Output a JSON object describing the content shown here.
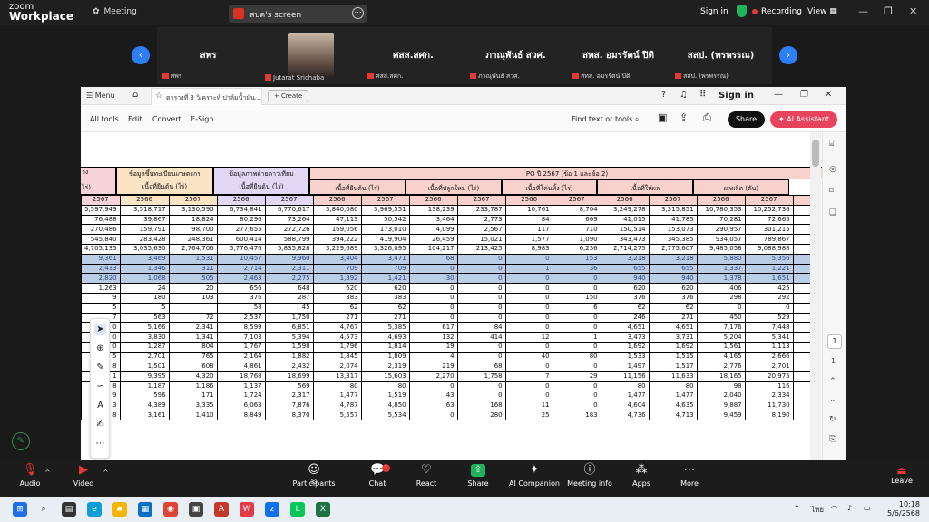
{
  "zoom": {
    "logo_line1": "zoom",
    "logo_line2": "Workplace",
    "meeting_label": "Meeting",
    "share_pill": "สปค's screen",
    "sign_in": "Sign in",
    "recording": "Recording",
    "view": "View"
  },
  "participants": [
    {
      "big": "สพร",
      "small": "สพร"
    },
    {
      "big": "",
      "small": "Jutarat Srichaba"
    },
    {
      "big": "ศสส.สศก.",
      "small": "ศสส.สศก."
    },
    {
      "big": "ภาณุพันธ์ สวศ.",
      "small": "ภาณุพันธ์ สวศ."
    },
    {
      "big": "สทส. อมรรัตน์  ปิติ",
      "small": "สทส. อมรรัตน์  ปิติ"
    },
    {
      "big": "สสป. (พรพรรณ)",
      "small": "สสป. (พรพรรณ)"
    }
  ],
  "pdf": {
    "menu": "Menu",
    "tab_title": "ตารางที่ 3 วิเคราะห์ ปาล์มน้ำมัน...",
    "create": "Create",
    "sign_in": "Sign in",
    "toolbar": [
      "All tools",
      "Edit",
      "Convert",
      "E-Sign"
    ],
    "find": "Find text or tools",
    "share": "Share",
    "ai": "AI Assistant",
    "page_current": "1",
    "page_total": "1"
  },
  "table": {
    "group_left": "าง",
    "group1_title": "ข้อมูลขึ้นทะเบียนเกษตรกร",
    "group1_sub": "เนื้อที่ยืนต้น (ไร่)",
    "group2_title": "ข้อมูลภาพถ่ายดาวเทียม",
    "group2_sub": "เนื้อที่ยืนต้น (ไร่)",
    "po_title": "PO ปี 2567 (ข้อ 1 และข้อ 2)",
    "po_subs": [
      "เนื้อที่ยืนต้น (ไร่)",
      "เนื้อที่ปลูกใหม่ (ไร่)",
      "เนื้อที่โค่นทิ้ง (ไร่)",
      "เนื้อที่ให้ผล",
      "ผลผลิต (ตัน)"
    ],
    "left_stub": "ไร่)",
    "years": [
      "2567",
      "2566",
      "2567",
      "2566",
      "2567",
      "2566",
      "2567",
      "2566",
      "2567",
      "2566",
      "2567",
      "2566",
      "2567",
      "2566",
      "2567"
    ],
    "rows": [
      [
        "5,597,949",
        "3,518,717",
        "3,130,590",
        "6,734,841",
        "6,770,617",
        "3,840,080",
        "3,969,551",
        "138,239",
        "233,787",
        "10,761",
        "8,704",
        "3,249,278",
        "3,315,851",
        "10,780,353",
        "10,252,736"
      ],
      [
        "76,488",
        "39,867",
        "18,824",
        "80,296",
        "73,264",
        "47,113",
        "50,542",
        "3,464",
        "2,773",
        "84",
        "669",
        "41,015",
        "41,785",
        "70,281",
        "72,665"
      ],
      [
        "270,486",
        "159,791",
        "98,700",
        "277,655",
        "272,726",
        "169,056",
        "173,010",
        "4,099",
        "2,567",
        "117",
        "710",
        "150,514",
        "153,073",
        "290,957",
        "301,215"
      ],
      [
        "545,840",
        "283,428",
        "248,361",
        "600,414",
        "588,799",
        "394,222",
        "419,904",
        "26,459",
        "15,021",
        "1,577",
        "1,090",
        "343,473",
        "345,385",
        "934,057",
        "789,867"
      ],
      [
        "4,705,135",
        "3,035,630",
        "2,764,706",
        "5,776,476",
        "5,835,828",
        "3,229,689",
        "3,326,095",
        "104,217",
        "213,425",
        "8,983",
        "6,236",
        "2,714,275",
        "2,775,607",
        "9,485,058",
        "9,088,988"
      ],
      [
        "9,361",
        "3,469",
        "1,531",
        "10,457",
        "9,960",
        "3,404",
        "3,471",
        "68",
        "0",
        "0",
        "153",
        "3,218",
        "3,218",
        "5,880",
        "5,356"
      ],
      [
        "2,433",
        "1,346",
        "311",
        "2,714",
        "2,311",
        "709",
        "709",
        "0",
        "0",
        "1",
        "36",
        "655",
        "655",
        "1,337",
        "1,221"
      ],
      [
        "2,820",
        "1,068",
        "505",
        "2,463",
        "2,275",
        "1,392",
        "1,421",
        "30",
        "0",
        "0",
        "0",
        "940",
        "940",
        "1,378",
        "1,651"
      ],
      [
        "1,263",
        "24",
        "20",
        "656",
        "648",
        "620",
        "620",
        "0",
        "0",
        "0",
        "0",
        "620",
        "620",
        "406",
        "425"
      ],
      [
        "9",
        "180",
        "103",
        "376",
        "287",
        "383",
        "383",
        "0",
        "0",
        "0",
        "150",
        "376",
        "376",
        "298",
        "292"
      ],
      [
        "5",
        "5",
        "",
        "58",
        "45",
        "62",
        "62",
        "0",
        "0",
        "0",
        "6",
        "62",
        "62",
        "0",
        "0"
      ],
      [
        "7",
        "563",
        "72",
        "2,537",
        "1,750",
        "271",
        "271",
        "0",
        "0",
        "0",
        "0",
        "246",
        "271",
        "450",
        "529"
      ],
      [
        "0",
        "5,166",
        "2,341",
        "8,599",
        "6,851",
        "4,767",
        "5,385",
        "617",
        "84",
        "0",
        "0",
        "4,651",
        "4,651",
        "7,176",
        "7,448"
      ],
      [
        "0",
        "3,830",
        "1,341",
        "7,103",
        "5,394",
        "4,573",
        "4,693",
        "132",
        "414",
        "12",
        "1",
        "3,473",
        "3,731",
        "5,204",
        "5,341"
      ],
      [
        "0",
        "1,287",
        "804",
        "1,767",
        "1,598",
        "1,796",
        "1,814",
        "19",
        "0",
        "0",
        "0",
        "1,692",
        "1,692",
        "1,561",
        "1,113"
      ],
      [
        "5",
        "2,701",
        "765",
        "2,164",
        "1,882",
        "1,845",
        "1,809",
        "4",
        "0",
        "40",
        "80",
        "1,533",
        "1,515",
        "4,165",
        "2,666"
      ],
      [
        "8",
        "1,501",
        "608",
        "4,861",
        "2,432",
        "2,074",
        "2,319",
        "219",
        "68",
        "0",
        "0",
        "1,497",
        "1,517",
        "2,776",
        "2,701"
      ],
      [
        "1",
        "9,395",
        "4,320",
        "18,768",
        "18,699",
        "13,317",
        "15,603",
        "2,270",
        "1,758",
        "7",
        "29",
        "11,156",
        "11,633",
        "18,165",
        "20,975"
      ],
      [
        "8",
        "1,187",
        "1,186",
        "1,137",
        "569",
        "80",
        "80",
        "0",
        "0",
        "0",
        "0",
        "80",
        "80",
        "98",
        "116"
      ],
      [
        "9",
        "596",
        "171",
        "1,724",
        "2,317",
        "1,477",
        "1,519",
        "43",
        "0",
        "0",
        "0",
        "1,477",
        "1,477",
        "2,040",
        "2,334"
      ],
      [
        "3",
        "4,389",
        "3,335",
        "6,063",
        "7,876",
        "4,787",
        "4,850",
        "63",
        "168",
        "11",
        "0",
        "4,604",
        "4,635",
        "9,887",
        "11,730"
      ],
      [
        "8",
        "3,161",
        "1,410",
        "8,849",
        "8,370",
        "5,557",
        "5,534",
        "0",
        "280",
        "25",
        "183",
        "4,736",
        "4,713",
        "9,459",
        "8,190"
      ]
    ]
  },
  "bottom_bar": [
    {
      "label": "Audio",
      "icon": "mic-muted-icon"
    },
    {
      "label": "Video",
      "icon": "video-off-icon"
    },
    {
      "label": "Participants",
      "icon": "participants-icon",
      "count": "33"
    },
    {
      "label": "Chat",
      "icon": "chat-icon",
      "badge": "1"
    },
    {
      "label": "React",
      "icon": "heart-icon"
    },
    {
      "label": "Share",
      "icon": "share-icon"
    },
    {
      "label": "AI Companion",
      "icon": "ai-companion-icon"
    },
    {
      "label": "Meeting info",
      "icon": "info-icon"
    },
    {
      "label": "Apps",
      "icon": "apps-icon"
    },
    {
      "label": "More",
      "icon": "more-icon"
    }
  ],
  "leave": "Leave",
  "taskbar": {
    "lang": "ไทย",
    "time": "10:18",
    "date": "5/6/2568"
  },
  "colors": {
    "zoom_blue": "#2d7ff9",
    "record_red": "#e53935",
    "ai_pink": "#e8435c",
    "highlight": "#b9cde6"
  }
}
